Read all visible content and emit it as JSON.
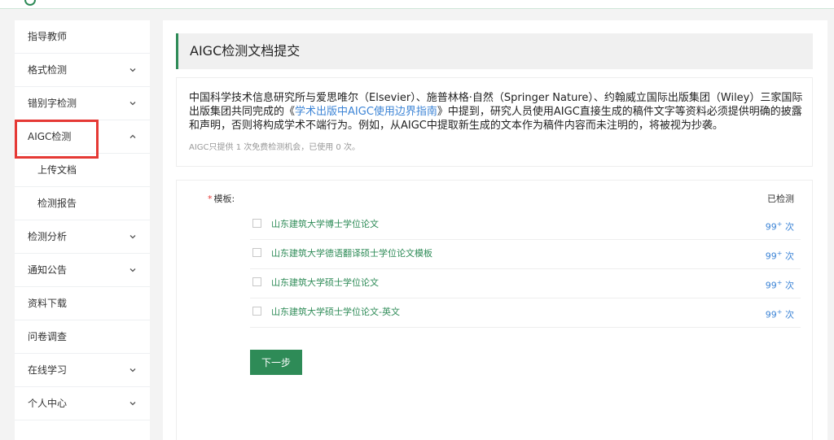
{
  "sidebar": {
    "items": [
      {
        "label": "指导教师",
        "expandable": false
      },
      {
        "label": "格式检测",
        "expandable": true,
        "expanded": false
      },
      {
        "label": "错别字检测",
        "expandable": true,
        "expanded": false
      },
      {
        "label": "AIGC检测",
        "expandable": true,
        "expanded": true,
        "highlighted": true
      },
      {
        "label": "上传文档",
        "sub": true
      },
      {
        "label": "检测报告",
        "sub": true
      },
      {
        "label": "检测分析",
        "expandable": true,
        "expanded": false
      },
      {
        "label": "通知公告",
        "expandable": true,
        "expanded": false
      },
      {
        "label": "资料下载",
        "expandable": false
      },
      {
        "label": "问卷调查",
        "expandable": false
      },
      {
        "label": "在线学习",
        "expandable": true,
        "expanded": false
      },
      {
        "label": "个人中心",
        "expandable": true,
        "expanded": false
      }
    ]
  },
  "main": {
    "title": "AIGC检测文档提交",
    "notice": {
      "before_link": "中国科学技术信息研究所与爱思唯尔（Elsevier）、施普林格·自然（Springer Nature）、约翰威立国际出版集团（Wiley）三家国际出版集团共同完成的《",
      "link": "学术出版中AIGC使用边界指南",
      "after_link": "》中提到，研究人员使用AIGC直接生成的稿件文字等资料必须提供明确的披露和声明，否则将构成学术不端行为。例如，从AIGC中提取新生成的文本作为稿件内容而未注明的，将被视为抄袭。"
    },
    "usage": "AIGC只提供 1 次免费检测机会，已使用 0 次。",
    "template_label": "模板:",
    "required_mark": "*",
    "checked_header": "已检测",
    "templates": [
      {
        "name": "山东建筑大学博士学位论文",
        "count": "99",
        "count_sup": "+",
        "unit": " 次",
        "checked": false
      },
      {
        "name": "山东建筑大学德语翻译硕士学位论文模板",
        "count": "99",
        "count_sup": "+",
        "unit": " 次",
        "checked": false
      },
      {
        "name": "山东建筑大学硕士学位论文",
        "count": "99",
        "count_sup": "+",
        "unit": " 次",
        "checked": false
      },
      {
        "name": "山东建筑大学硕士学位论文-英文",
        "count": "99",
        "count_sup": "+",
        "unit": " 次",
        "checked": false
      }
    ],
    "next_button": "下一步"
  },
  "colors": {
    "accent": "#2e8b57",
    "link": "#3c84d6",
    "highlight_box": "#e53935",
    "background": "#f3f3f3"
  },
  "icons": {
    "collapsed": "chevron-down-icon",
    "expanded": "chevron-up-icon",
    "logo": "logo-icon"
  }
}
